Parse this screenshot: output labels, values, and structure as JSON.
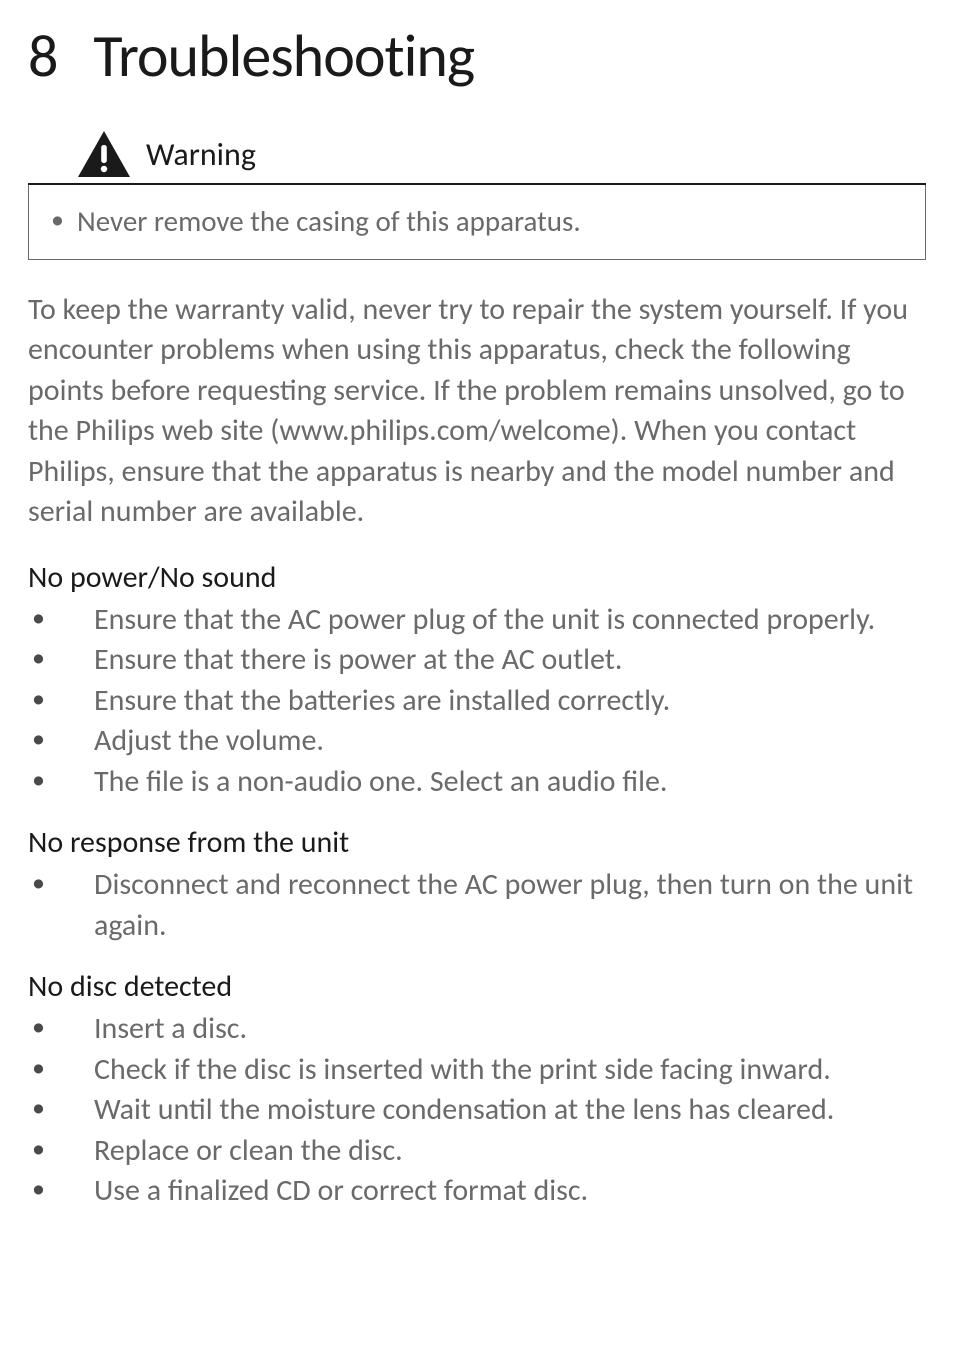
{
  "chapter": {
    "number": "8",
    "title": "Troubleshooting"
  },
  "warning": {
    "label": "Warning",
    "items": [
      "Never remove the casing of this apparatus."
    ]
  },
  "intro": "To keep the warranty valid, never try to repair the system yourself. If you encounter problems when using this apparatus, check the following points before requesting service. If the problem remains unsolved, go to the Philips web site (www.philips.com/welcome). When you contact Philips, ensure that the apparatus is nearby and the model number and serial number are available.",
  "sections": [
    {
      "title": "No power/No sound",
      "items": [
        "Ensure that the AC power plug of the unit is connected properly.",
        "Ensure that there is power at the AC outlet.",
        "Ensure that the batteries are installed correctly.",
        "Adjust the volume.",
        "The file is a non-audio one. Select an audio file."
      ]
    },
    {
      "title": "No response from the unit",
      "items": [
        "Disconnect and reconnect the AC power plug, then turn on the unit again."
      ]
    },
    {
      "title": "No disc detected",
      "items": [
        "Insert a disc.",
        "Check if the disc is inserted with the print side facing inward.",
        "Wait until the moisture condensation at the lens has cleared.",
        "Replace or clean the disc.",
        "Use a finalized CD or correct format disc."
      ]
    }
  ]
}
